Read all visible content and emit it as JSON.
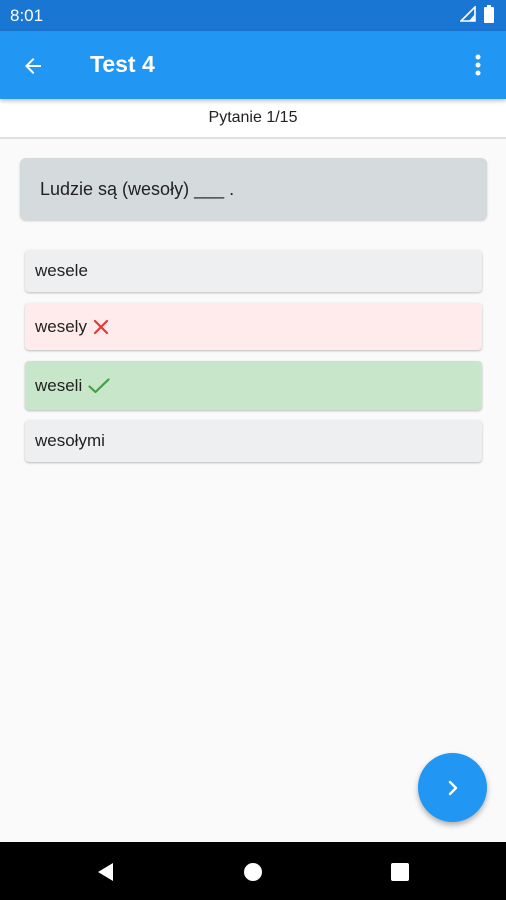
{
  "status_bar": {
    "time": "8:01",
    "icons": [
      "signal-icon",
      "battery-icon"
    ]
  },
  "app_bar": {
    "title": "Test 4",
    "back_icon": "arrow-back-icon",
    "menu_icon": "more-vert-icon"
  },
  "progress": {
    "label": "Pytanie 1/15"
  },
  "question": {
    "text": "Ludzie są (wesoły) ___ ."
  },
  "answers": [
    {
      "text": "wesele",
      "state": "neutral"
    },
    {
      "text": "wesely",
      "state": "wrong",
      "icon": "close-icon"
    },
    {
      "text": "weseli",
      "state": "correct",
      "icon": "check-icon"
    },
    {
      "text": "wesołymi",
      "state": "neutral"
    }
  ],
  "fab": {
    "icon": "chevron-right-icon"
  },
  "nav_bar": {
    "icons": [
      "back-triangle-icon",
      "home-circle-icon",
      "recents-square-icon"
    ]
  },
  "colors": {
    "primary": "#2196f3",
    "status_bar": "#1976d2",
    "wrong": "#e53935",
    "correct": "#43a047"
  }
}
